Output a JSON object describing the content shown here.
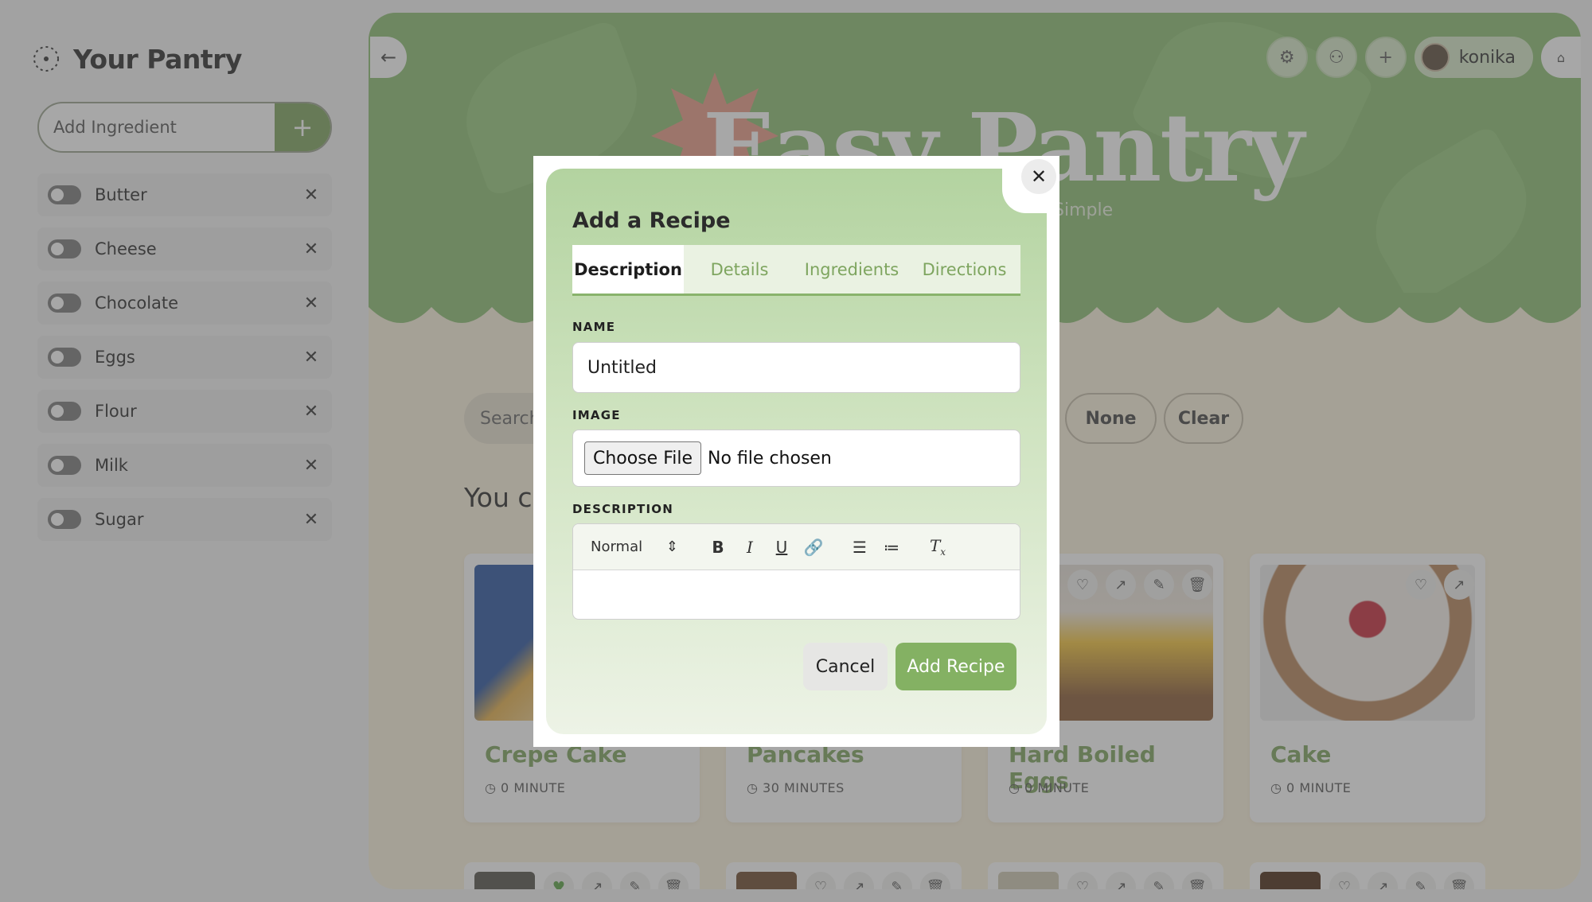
{
  "sidebar": {
    "brand": "Your Pantry",
    "add_placeholder": "Add Ingredient",
    "add_button": "+",
    "ingredients": [
      {
        "label": "Butter"
      },
      {
        "label": "Cheese"
      },
      {
        "label": "Chocolate"
      },
      {
        "label": "Eggs"
      },
      {
        "label": "Flour"
      },
      {
        "label": "Milk"
      },
      {
        "label": "Sugar"
      }
    ],
    "remove_glyph": "✕"
  },
  "header": {
    "title": "Easy Pantry",
    "subtitle": "Simple",
    "user": "konika"
  },
  "filters": {
    "search_placeholder": "Search",
    "done_label": "None",
    "clear_label": "Clear"
  },
  "section_heading": "You ca",
  "recipes": [
    {
      "title": "Crepe Cake",
      "time": "0 MINUTE"
    },
    {
      "title": "Pancakes",
      "time": "30 MINUTES"
    },
    {
      "title": "Hard Boiled Eggs",
      "time": "0 MINUTE"
    },
    {
      "title": "Cake",
      "time": "0 MINUTE"
    }
  ],
  "modal": {
    "title": "Add a Recipe",
    "tabs": [
      "Description",
      "Details",
      "Ingredients",
      "Directions"
    ],
    "active_tab": "Description",
    "name_label": "NAME",
    "name_value": "Untitled",
    "image_label": "IMAGE",
    "choose_file": "Choose File",
    "no_file": "No file chosen",
    "description_label": "DESCRIPTION",
    "format_select": "Normal",
    "cancel": "Cancel",
    "submit": "Add Recipe",
    "close_glyph": "✕"
  },
  "colors": {
    "accent_green": "#84b163",
    "hero_green": "#8cbf72",
    "cream": "#fbf2dc"
  }
}
